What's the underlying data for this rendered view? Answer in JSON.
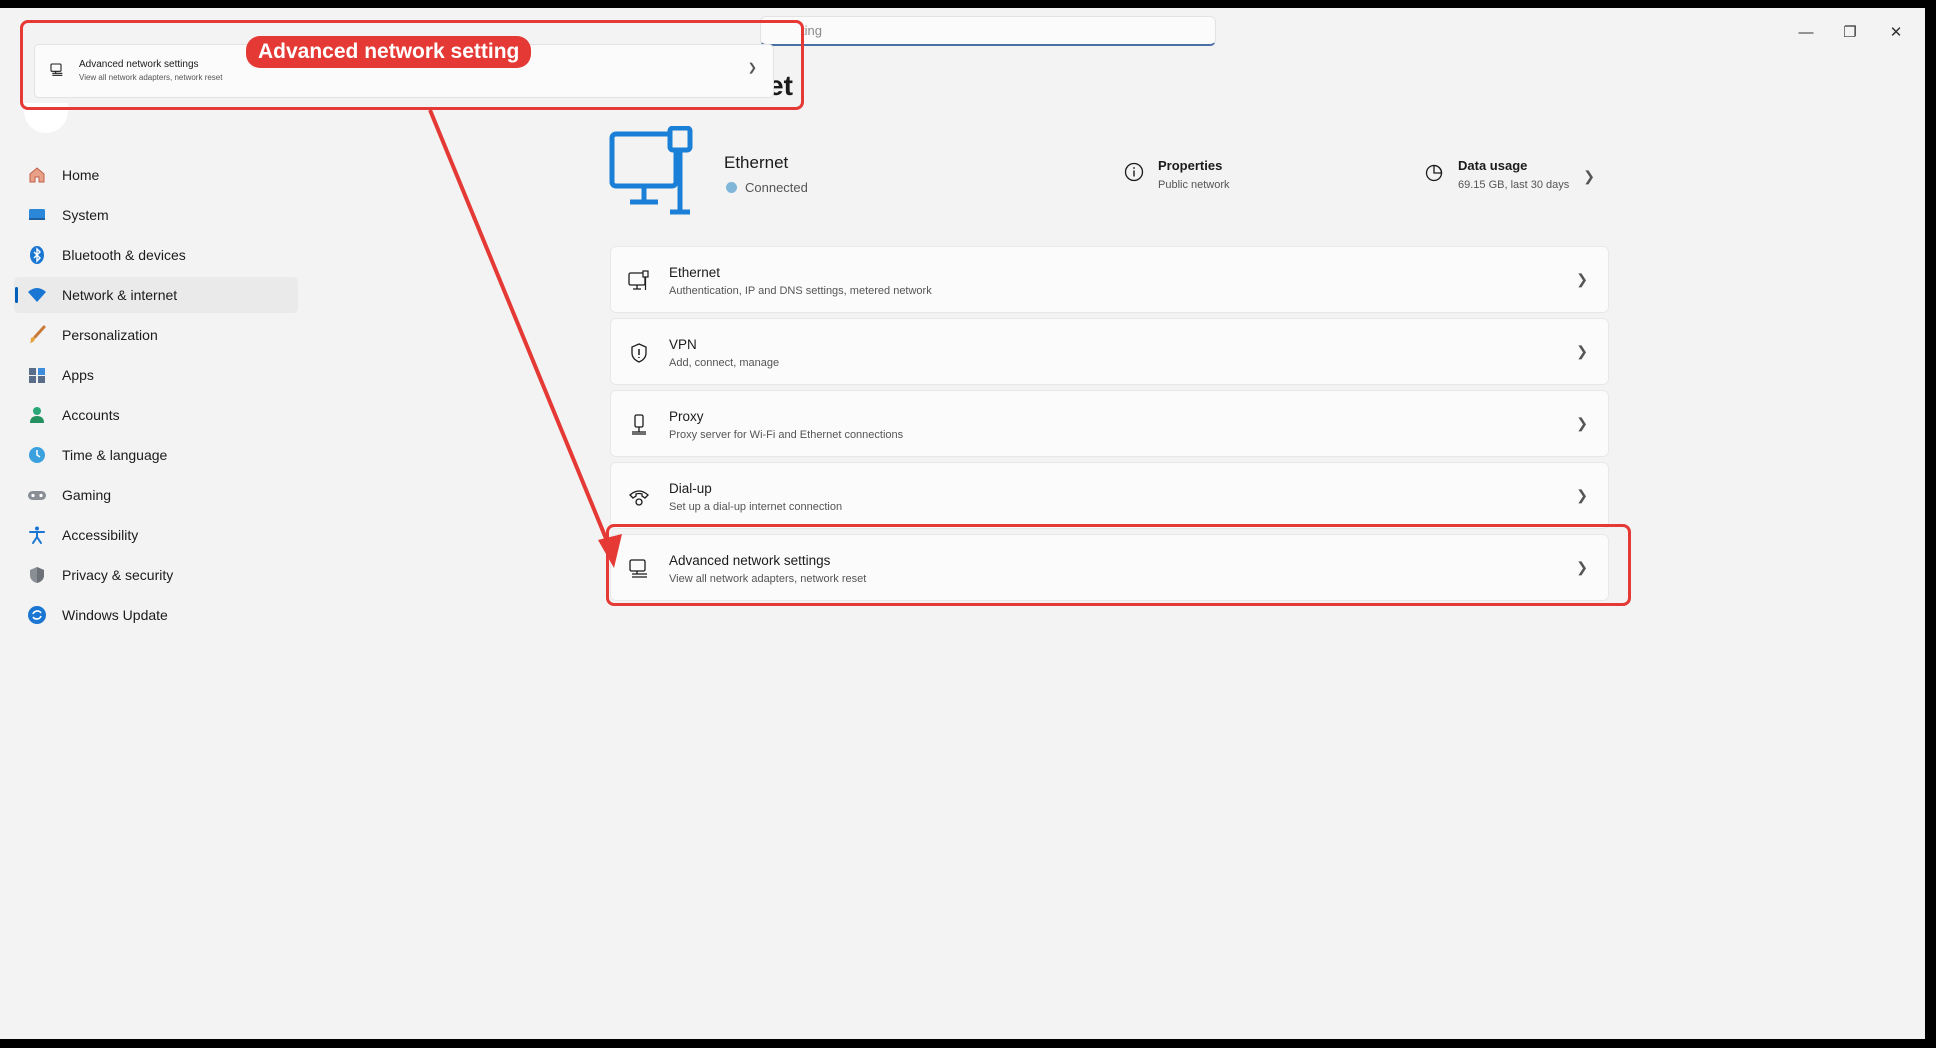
{
  "window": {
    "search_placeholder": "ting",
    "page_title": "rnet",
    "controls": {
      "minimize": "—",
      "maximize": "❐",
      "close": "✕"
    }
  },
  "sidebar": {
    "items": [
      {
        "label": "Home",
        "icon": "home-icon",
        "active": false
      },
      {
        "label": "System",
        "icon": "system-icon",
        "active": false
      },
      {
        "label": "Bluetooth & devices",
        "icon": "bluetooth-icon",
        "active": false
      },
      {
        "label": "Network & internet",
        "icon": "wifi-icon",
        "active": true
      },
      {
        "label": "Personalization",
        "icon": "brush-icon",
        "active": false
      },
      {
        "label": "Apps",
        "icon": "apps-icon",
        "active": false
      },
      {
        "label": "Accounts",
        "icon": "accounts-icon",
        "active": false
      },
      {
        "label": "Time & language",
        "icon": "globe-clock-icon",
        "active": false
      },
      {
        "label": "Gaming",
        "icon": "gamepad-icon",
        "active": false
      },
      {
        "label": "Accessibility",
        "icon": "accessibility-icon",
        "active": false
      },
      {
        "label": "Privacy & security",
        "icon": "shield-icon",
        "active": false
      },
      {
        "label": "Windows Update",
        "icon": "update-icon",
        "active": false
      }
    ]
  },
  "header": {
    "adapter_name": "Ethernet",
    "status": "Connected",
    "properties_title": "Properties",
    "properties_sub": "Public network",
    "data_usage_title": "Data usage",
    "data_usage_sub": "69.15 GB, last 30 days"
  },
  "rows": [
    {
      "title": "Ethernet",
      "sub": "Authentication, IP and DNS settings, metered network",
      "icon": "ethernet-icon"
    },
    {
      "title": "VPN",
      "sub": "Add, connect, manage",
      "icon": "vpn-shield-icon"
    },
    {
      "title": "Proxy",
      "sub": "Proxy server for Wi-Fi and Ethernet connections",
      "icon": "proxy-icon"
    },
    {
      "title": "Dial-up",
      "sub": "Set up a dial-up internet connection",
      "icon": "dialup-icon"
    },
    {
      "title": "Advanced network settings",
      "sub": "View all network adapters, network reset",
      "icon": "network-adapter-icon"
    }
  ],
  "annotation": {
    "label": "Advanced network setting",
    "zoom_title": "Advanced network settings",
    "zoom_sub": "View all network adapters, network reset",
    "color": "#e53935"
  },
  "colors": {
    "accent": "#005fb8",
    "ethernet_icon": "#1a7fd6"
  }
}
